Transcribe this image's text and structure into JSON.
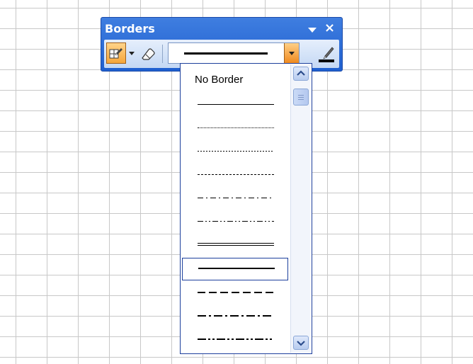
{
  "toolbar": {
    "title": "Borders",
    "close_glyph": "×",
    "icons": [
      "draw-border-icon",
      "chevron-down-icon",
      "eraser-icon",
      "line-color-icon",
      "close-icon"
    ]
  },
  "line_style_dropdown": {
    "selected_style": "medium-solid",
    "items": [
      "No Border",
      "thin-solid",
      "hair",
      "dotted",
      "dashed",
      "dash-dot",
      "dash-dot-dot",
      "double",
      "medium-solid",
      "medium-dashed",
      "medium-dash-dot",
      "medium-dash-dot-dot"
    ]
  },
  "colors": {
    "title_bar": "#2a68d8",
    "active_button": "#f6a63a",
    "selection_border": "#1c3f9c"
  }
}
